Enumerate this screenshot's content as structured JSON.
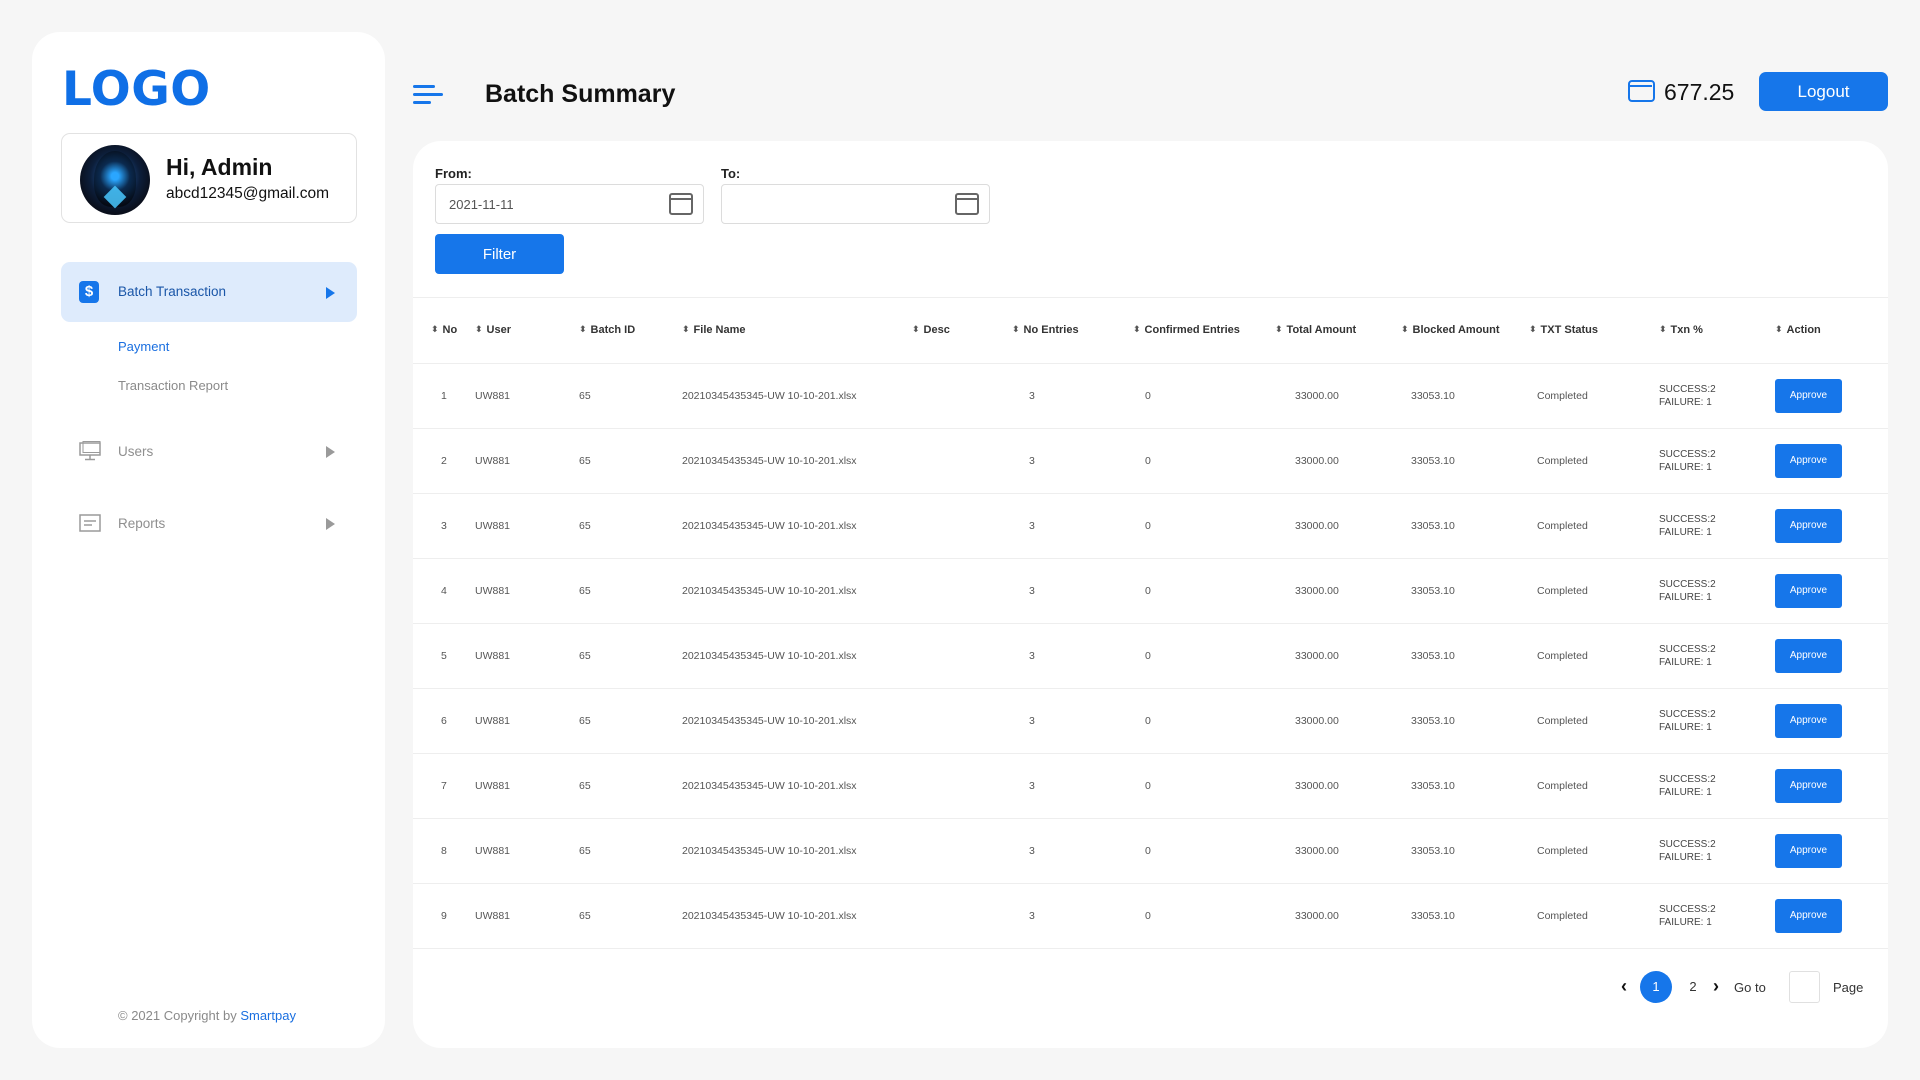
{
  "sidebar": {
    "logo": "LOGO",
    "profile": {
      "greeting": "Hi, Admin",
      "email": "abcd12345@gmail.com"
    },
    "active_item": {
      "label": "Batch Transaction"
    },
    "sub_items": [
      {
        "label": "Payment"
      },
      {
        "label": "Transaction Report"
      }
    ],
    "items": [
      {
        "label": "Users"
      },
      {
        "label": "Reports"
      }
    ],
    "copyright": {
      "prefix": "© 2021 Copyright by",
      "brand": "Smartpay"
    }
  },
  "header": {
    "title": "Batch Summary",
    "balance": "677.25",
    "logout_label": "Logout"
  },
  "filters": {
    "from_label": "From:",
    "from_value": "2021-11-11",
    "to_label": "To:",
    "to_value": "",
    "filter_label": "Filter"
  },
  "table": {
    "sort_glyph": "⬍",
    "columns": [
      "No",
      "User",
      "Batch ID",
      "File Name",
      "Desc",
      "No Entries",
      "Confirmed Entries",
      "Total Amount",
      "Blocked Amount",
      "TXT Status",
      "Txn %",
      "Action"
    ],
    "rows": [
      {
        "no": "1",
        "user": "UW881",
        "batch_id": "65",
        "file_name": "20210345435345-UW 10-10-201.xlsx",
        "desc": "",
        "no_entries": "3",
        "confirmed": "0",
        "total": "33000.00",
        "blocked": "33053.10",
        "status": "Completed",
        "success": "SUCCESS:2",
        "failure": "FAILURE: 1",
        "action": "Approve"
      },
      {
        "no": "2",
        "user": "UW881",
        "batch_id": "65",
        "file_name": "20210345435345-UW 10-10-201.xlsx",
        "desc": "",
        "no_entries": "3",
        "confirmed": "0",
        "total": "33000.00",
        "blocked": "33053.10",
        "status": "Completed",
        "success": "SUCCESS:2",
        "failure": "FAILURE: 1",
        "action": "Approve"
      },
      {
        "no": "3",
        "user": "UW881",
        "batch_id": "65",
        "file_name": "20210345435345-UW 10-10-201.xlsx",
        "desc": "",
        "no_entries": "3",
        "confirmed": "0",
        "total": "33000.00",
        "blocked": "33053.10",
        "status": "Completed",
        "success": "SUCCESS:2",
        "failure": "FAILURE: 1",
        "action": "Approve"
      },
      {
        "no": "4",
        "user": "UW881",
        "batch_id": "65",
        "file_name": "20210345435345-UW 10-10-201.xlsx",
        "desc": "",
        "no_entries": "3",
        "confirmed": "0",
        "total": "33000.00",
        "blocked": "33053.10",
        "status": "Completed",
        "success": "SUCCESS:2",
        "failure": "FAILURE: 1",
        "action": "Approve"
      },
      {
        "no": "5",
        "user": "UW881",
        "batch_id": "65",
        "file_name": "20210345435345-UW 10-10-201.xlsx",
        "desc": "",
        "no_entries": "3",
        "confirmed": "0",
        "total": "33000.00",
        "blocked": "33053.10",
        "status": "Completed",
        "success": "SUCCESS:2",
        "failure": "FAILURE: 1",
        "action": "Approve"
      },
      {
        "no": "6",
        "user": "UW881",
        "batch_id": "65",
        "file_name": "20210345435345-UW 10-10-201.xlsx",
        "desc": "",
        "no_entries": "3",
        "confirmed": "0",
        "total": "33000.00",
        "blocked": "33053.10",
        "status": "Completed",
        "success": "SUCCESS:2",
        "failure": "FAILURE: 1",
        "action": "Approve"
      },
      {
        "no": "7",
        "user": "UW881",
        "batch_id": "65",
        "file_name": "20210345435345-UW 10-10-201.xlsx",
        "desc": "",
        "no_entries": "3",
        "confirmed": "0",
        "total": "33000.00",
        "blocked": "33053.10",
        "status": "Completed",
        "success": "SUCCESS:2",
        "failure": "FAILURE: 1",
        "action": "Approve"
      },
      {
        "no": "8",
        "user": "UW881",
        "batch_id": "65",
        "file_name": "20210345435345-UW 10-10-201.xlsx",
        "desc": "",
        "no_entries": "3",
        "confirmed": "0",
        "total": "33000.00",
        "blocked": "33053.10",
        "status": "Completed",
        "success": "SUCCESS:2",
        "failure": "FAILURE: 1",
        "action": "Approve"
      },
      {
        "no": "9",
        "user": "UW881",
        "batch_id": "65",
        "file_name": "20210345435345-UW 10-10-201.xlsx",
        "desc": "",
        "no_entries": "3",
        "confirmed": "0",
        "total": "33000.00",
        "blocked": "33053.10",
        "status": "Completed",
        "success": "SUCCESS:2",
        "failure": "FAILURE: 1",
        "action": "Approve"
      }
    ]
  },
  "pagination": {
    "prev": "‹",
    "pages": [
      "1",
      "2"
    ],
    "next": "›",
    "goto_label": "Go to",
    "page_label": "Page"
  },
  "colors": {
    "accent": "#1676ea",
    "active_bg": "#deebfc"
  }
}
